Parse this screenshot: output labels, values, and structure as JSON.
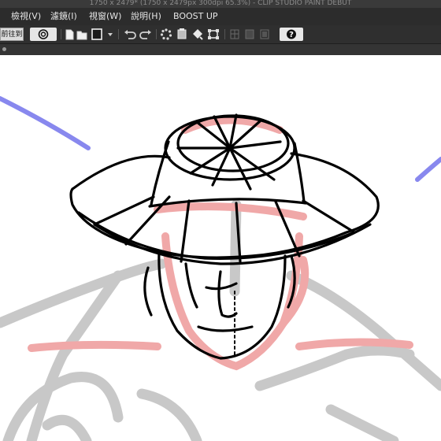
{
  "window": {
    "title": "1750 x 2479* (1750 x 2479px 300dpi 65.3%)  - CLIP STUDIO PAINT DEBUT"
  },
  "menu": {
    "items": [
      {
        "label": "檢視(V)"
      },
      {
        "label": "濾鏡(I)"
      },
      {
        "label": "視窗(W)"
      },
      {
        "label": "說明(H)"
      },
      {
        "label": "BOOST UP"
      }
    ]
  },
  "toolbar": {
    "home_label": "前往到",
    "icons": [
      "clip-studio-logo-icon",
      "new-file-icon",
      "open-folder-icon",
      "save-icon",
      "dropdown-arrow-icon",
      "undo-icon",
      "redo-icon",
      "loading-spinner-icon",
      "layer-icon",
      "fill-bucket-icon",
      "transform-icon",
      "grid-icon",
      "ruler-icon",
      "frame-icon",
      "help-icon"
    ]
  },
  "canvas": {
    "subject": "rough sketch of a figure wearing a wide-brimmed hat",
    "colors": {
      "lineart": "#000000",
      "gray_layer": "#c8c8c8",
      "red_layer": "#f0a8a8",
      "blue_layer": "#8888ee"
    }
  }
}
